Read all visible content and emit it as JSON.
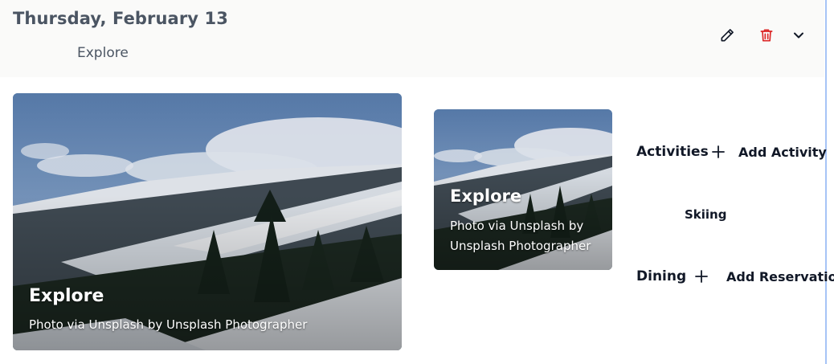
{
  "day": {
    "title": "Thursday, February 13",
    "subtitle": "Explore"
  },
  "actions": {
    "edit_icon": "pencil-icon",
    "delete_icon": "trash-icon",
    "expand_icon": "chevron-down-icon",
    "delete_color": "#dc2626"
  },
  "photos": [
    {
      "title": "Explore",
      "credit": "Photo via Unsplash by Unsplash Photographer"
    },
    {
      "title": "Explore",
      "credit": "Photo via Unsplash by Unsplash Photographer"
    }
  ],
  "activities": {
    "title": "Activities",
    "add_label": "Add Activity",
    "items": [
      "Skiing"
    ]
  },
  "dining": {
    "title": "Dining",
    "add_label": "Add Reservation"
  },
  "colors": {
    "accent_line": "#a6c4f6",
    "header_bg": "#fafaf9"
  }
}
